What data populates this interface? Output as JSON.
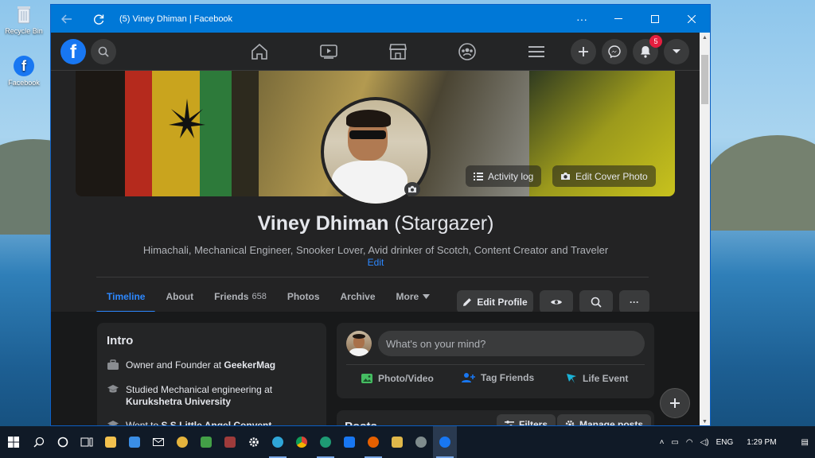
{
  "desktop": {
    "icons": [
      {
        "label": "Recycle Bin",
        "icon": "recycle-bin-icon"
      },
      {
        "label": "Facebook",
        "icon": "facebook-icon"
      }
    ]
  },
  "window": {
    "title": "(5) Viney Dhiman | Facebook",
    "menu_glyph": "···"
  },
  "fbnav": {
    "logo": "f",
    "notification_count": "5",
    "center_icons": [
      "home-icon",
      "watch-icon",
      "marketplace-icon",
      "groups-icon",
      "menu-icon"
    ],
    "right_icons": [
      "create-icon",
      "messenger-icon",
      "notifications-icon",
      "account-icon"
    ]
  },
  "cover": {
    "activity_log_label": "Activity log",
    "edit_cover_label": "Edit Cover Photo"
  },
  "profile": {
    "name": "Viney Dhiman",
    "alt_name": "(Stargazer)",
    "bio": "Himachali, Mechanical Engineer, Snooker Lover, Avid drinker of Scotch, Content Creator and Traveler",
    "bio_edit": "Edit"
  },
  "tabs": [
    {
      "label": "Timeline",
      "count": ""
    },
    {
      "label": "About",
      "count": ""
    },
    {
      "label": "Friends",
      "count": "658"
    },
    {
      "label": "Photos",
      "count": ""
    },
    {
      "label": "Archive",
      "count": ""
    },
    {
      "label": "More",
      "count": ""
    }
  ],
  "actions": {
    "edit_profile": "Edit Profile",
    "more_glyph": "···"
  },
  "intro": {
    "title": "Intro",
    "rows": [
      {
        "prefix": "Owner and Founder at ",
        "bold": "GeekerMag",
        "icon": "briefcase-icon"
      },
      {
        "prefix": "Studied Mechanical engineering at ",
        "bold": "Kurukshetra University",
        "icon": "graduation-cap-icon"
      },
      {
        "prefix": "Went to ",
        "bold": "S.S Little Angel Convent",
        "icon": "graduation-cap-icon"
      }
    ]
  },
  "composer": {
    "placeholder": "What's on your mind?",
    "photo_video": "Photo/Video",
    "tag_friends": "Tag Friends",
    "life_event": "Life Event"
  },
  "posts": {
    "title": "Posts",
    "filters": "Filters",
    "manage": "Manage posts"
  },
  "taskbar": {
    "lang": "ENG",
    "time": "1:29 PM"
  },
  "colors": {
    "accent": "#2d88ff",
    "fb_blue": "#1877f2",
    "titlebar": "#0078d7",
    "badge": "#e41e3f"
  }
}
